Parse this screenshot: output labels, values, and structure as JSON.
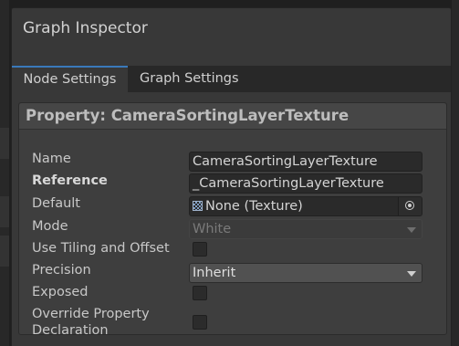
{
  "window": {
    "title": "Graph Inspector",
    "tabs": [
      {
        "label": "Node Settings",
        "active": true
      },
      {
        "label": "Graph Settings",
        "active": false
      }
    ]
  },
  "panel": {
    "header": "Property: CameraSortingLayerTexture",
    "rows": {
      "name": {
        "label": "Name",
        "value": "CameraSortingLayerTexture"
      },
      "reference": {
        "label": "Reference",
        "value": "_CameraSortingLayerTexture"
      },
      "default": {
        "label": "Default",
        "value": "None (Texture)",
        "icon": "texture-icon"
      },
      "mode": {
        "label": "Mode",
        "value": "White",
        "enabled": false
      },
      "tiling": {
        "label": "Use Tiling and Offset",
        "checked": false
      },
      "precision": {
        "label": "Precision",
        "value": "Inherit"
      },
      "exposed": {
        "label": "Exposed",
        "checked": false
      },
      "override": {
        "label_line1": "Override Property",
        "label_line2": "Declaration",
        "checked": false
      }
    }
  },
  "colors": {
    "accent": "#3a79bb",
    "background": "#383838",
    "panel": "#3e3e3e",
    "field": "#2a2a2a"
  }
}
